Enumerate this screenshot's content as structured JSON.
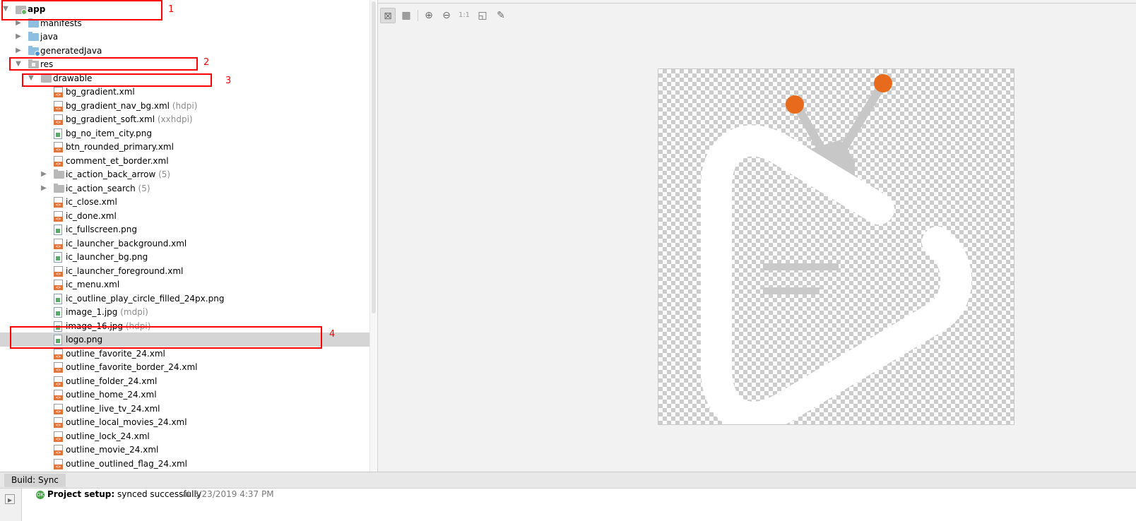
{
  "tree": {
    "rows": [
      {
        "label": "app",
        "bold": true,
        "suffix": ""
      },
      {
        "label": "manifests",
        "suffix": ""
      },
      {
        "label": "java",
        "suffix": ""
      },
      {
        "label": "generatedJava",
        "suffix": ""
      },
      {
        "label": "res",
        "suffix": ""
      },
      {
        "label": "drawable",
        "suffix": ""
      },
      {
        "label": "bg_gradient.xml",
        "suffix": ""
      },
      {
        "label": "bg_gradient_nav_bg.xml",
        "suffix": "(hdpi)"
      },
      {
        "label": "bg_gradient_soft.xml",
        "suffix": "(xxhdpi)"
      },
      {
        "label": "bg_no_item_city.png",
        "suffix": ""
      },
      {
        "label": "btn_rounded_primary.xml",
        "suffix": ""
      },
      {
        "label": "comment_et_border.xml",
        "suffix": ""
      },
      {
        "label": "ic_action_back_arrow",
        "suffix": "(5)"
      },
      {
        "label": "ic_action_search",
        "suffix": "(5)"
      },
      {
        "label": "ic_close.xml",
        "suffix": ""
      },
      {
        "label": "ic_done.xml",
        "suffix": ""
      },
      {
        "label": "ic_fullscreen.png",
        "suffix": ""
      },
      {
        "label": "ic_launcher_background.xml",
        "suffix": ""
      },
      {
        "label": "ic_launcher_bg.png",
        "suffix": ""
      },
      {
        "label": "ic_launcher_foreground.xml",
        "suffix": ""
      },
      {
        "label": "ic_menu.xml",
        "suffix": ""
      },
      {
        "label": "ic_outline_play_circle_filled_24px.png",
        "suffix": ""
      },
      {
        "label": "image_1.jpg",
        "suffix": "(mdpi)"
      },
      {
        "label": "image_16.jpg",
        "suffix": "(hdpi)"
      },
      {
        "label": "logo.png",
        "suffix": ""
      },
      {
        "label": "outline_favorite_24.xml",
        "suffix": ""
      },
      {
        "label": "outline_favorite_border_24.xml",
        "suffix": ""
      },
      {
        "label": "outline_folder_24.xml",
        "suffix": ""
      },
      {
        "label": "outline_home_24.xml",
        "suffix": ""
      },
      {
        "label": "outline_live_tv_24.xml",
        "suffix": ""
      },
      {
        "label": "outline_local_movies_24.xml",
        "suffix": ""
      },
      {
        "label": "outline_lock_24.xml",
        "suffix": ""
      },
      {
        "label": "outline_movie_24.xml",
        "suffix": ""
      },
      {
        "label": "outline_outlined_flag_24.xml",
        "suffix": ""
      }
    ],
    "selected_item": "logo.png"
  },
  "annotations": [
    "1",
    "2",
    "3",
    "4"
  ],
  "toolbar": {
    "zoom_actual_label": "1:1",
    "icons": [
      "transparency-toggle-icon",
      "grid-icon",
      "zoom-in-icon",
      "zoom-out-icon",
      "actual-size-icon",
      "fit-to-window-icon",
      "color-picker-icon"
    ]
  },
  "preview": {
    "logo_colors": {
      "accent": "#e86a1c",
      "antenna": "#c7c7c7",
      "shape": "#ffffff",
      "lines": "#c9c9c9"
    }
  },
  "build": {
    "tab_label": "Build: Sync",
    "status_bold": "Project setup:",
    "status_text": "synced successfully",
    "timestamp": "at 3/23/2019 4:37 PM"
  }
}
